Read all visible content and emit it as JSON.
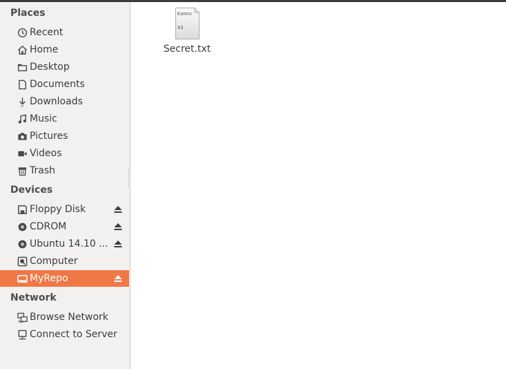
{
  "sidebar": {
    "places_title": "Places",
    "places": [
      {
        "label": "Recent",
        "icon": "clock-icon"
      },
      {
        "label": "Home",
        "icon": "home-icon"
      },
      {
        "label": "Desktop",
        "icon": "folder-icon"
      },
      {
        "label": "Documents",
        "icon": "document-icon"
      },
      {
        "label": "Downloads",
        "icon": "download-icon"
      },
      {
        "label": "Music",
        "icon": "music-icon"
      },
      {
        "label": "Pictures",
        "icon": "camera-icon"
      },
      {
        "label": "Videos",
        "icon": "video-icon"
      },
      {
        "label": "Trash",
        "icon": "trash-icon"
      }
    ],
    "devices_title": "Devices",
    "devices": [
      {
        "label": "Floppy Disk",
        "icon": "floppy-icon",
        "eject": true
      },
      {
        "label": "CDROM",
        "icon": "disc-icon",
        "eject": true
      },
      {
        "label": "Ubuntu 14.10 ...",
        "icon": "disc-icon",
        "eject": true
      },
      {
        "label": "Computer",
        "icon": "computer-icon",
        "eject": false
      },
      {
        "label": "MyRepo",
        "icon": "drive-icon",
        "eject": true,
        "selected": true
      }
    ],
    "network_title": "Network",
    "network": [
      {
        "label": "Browse Network",
        "icon": "network-icon"
      },
      {
        "label": "Connect to Server",
        "icon": "server-icon"
      }
    ]
  },
  "content": {
    "files": [
      {
        "name": "Secret.txt",
        "preview_line1": "Kanns",
        "preview_line2": "43",
        "icon": "text-file-icon"
      }
    ]
  },
  "colors": {
    "accent": "#f07746",
    "sidebar_bg": "#f2f1f0"
  }
}
